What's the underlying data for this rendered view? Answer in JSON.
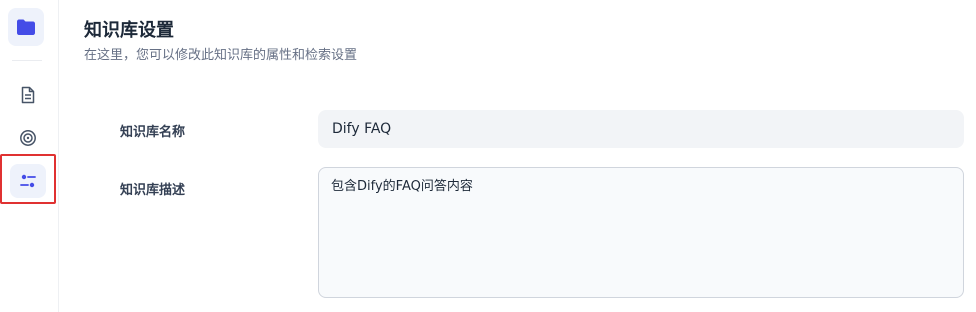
{
  "header": {
    "title": "知识库设置",
    "subtitle": "在这里，您可以修改此知识库的属性和检索设置"
  },
  "sidebar": {
    "items": [
      {
        "icon": "document-icon"
      },
      {
        "icon": "target-icon"
      },
      {
        "icon": "settings-sliders-icon",
        "active": true
      }
    ]
  },
  "form": {
    "name": {
      "label": "知识库名称",
      "value": "Dify FAQ"
    },
    "description": {
      "label": "知识库描述",
      "value": "包含Dify的FAQ问答内容"
    }
  },
  "colors": {
    "accent": "#444ce7",
    "highlight": "#e03131"
  }
}
